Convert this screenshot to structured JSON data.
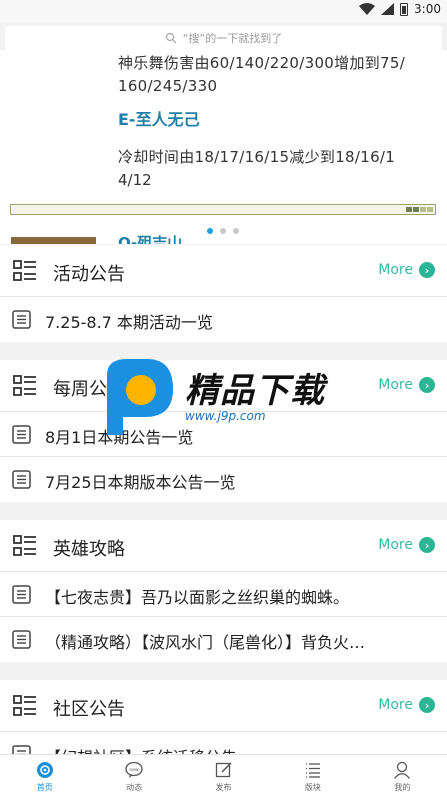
{
  "status_bar": {
    "time": "3:00"
  },
  "search": {
    "placeholder": "“搜”的一下就找到了"
  },
  "banner": {
    "line1": "神乐舞伤害由60/140/220/300增加到75/",
    "line2": "160/245/330",
    "skill_title": "E-至人无己",
    "desc_line1": "冷却时间由18/17/16/15减少到18/16/1",
    "desc_line2": "4/12",
    "next_title": "Q-殂吉山",
    "active_dot": 1,
    "dot_count": 3
  },
  "sections": [
    {
      "title": "活动公告",
      "more": "More",
      "items": [
        "7.25-8.7 本期活动一览"
      ]
    },
    {
      "title": "每周公告",
      "more": "More",
      "items": [
        "8月1日本期公告一览",
        "7月25日本期版本公告一览"
      ]
    },
    {
      "title": "英雄攻略",
      "more": "More",
      "items": [
        "【七夜志贵】吾乃以面影之丝织巢的蜘蛛。",
        "（精通攻略）【波风水门（尾兽化）】背负火…"
      ]
    },
    {
      "title": "社区公告",
      "more": "More",
      "items": [
        "【幻想社区】系统迁移公告"
      ]
    }
  ],
  "watermark": {
    "brand": "精品下载",
    "url": "www.j9p.com",
    "letter": "P"
  },
  "tabbar": {
    "tabs": [
      {
        "label": "首页",
        "icon": "home-icon",
        "active": true
      },
      {
        "label": "动态",
        "icon": "news-icon",
        "active": false
      },
      {
        "label": "发布",
        "icon": "edit-icon",
        "active": false
      },
      {
        "label": "版块",
        "icon": "list-icon",
        "active": false
      },
      {
        "label": "我的",
        "icon": "user-icon",
        "active": false
      }
    ]
  },
  "colors": {
    "accent": "#1a8fd8",
    "more": "#3cb8a4",
    "skill": "#1f7fa6"
  }
}
